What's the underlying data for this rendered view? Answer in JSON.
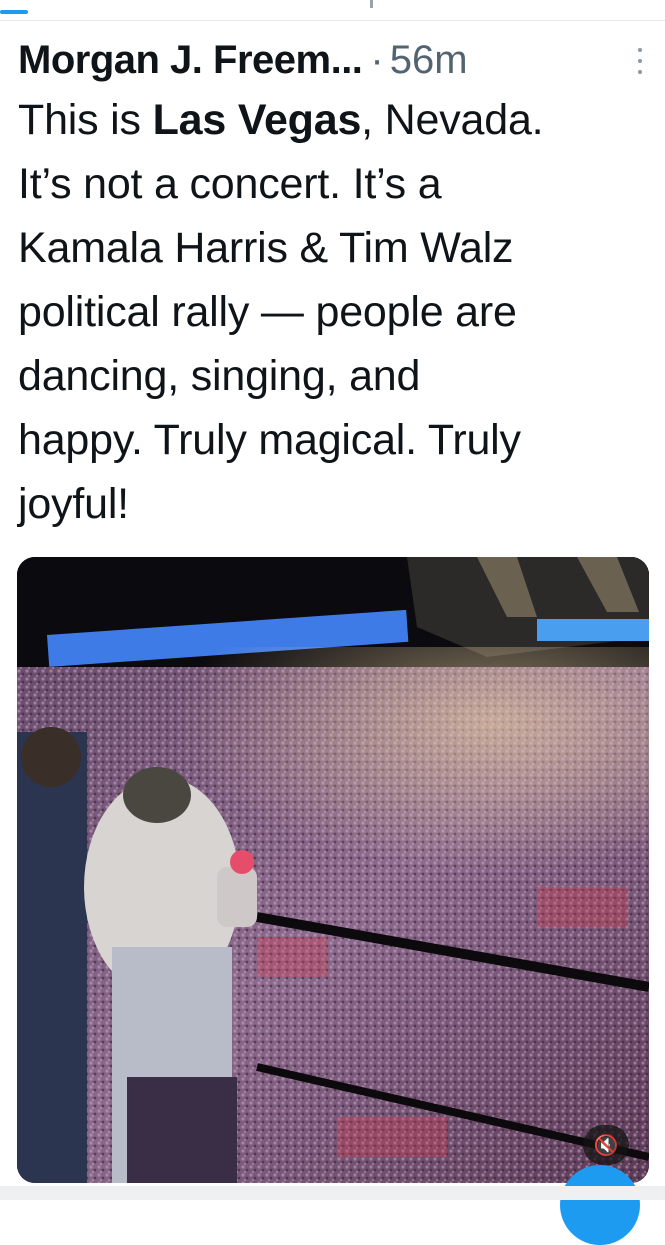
{
  "post": {
    "author_name": "Morgan J. Freem...",
    "separator": "·",
    "timestamp": "56m",
    "text_lines": [
      [
        "This is ",
        "Las Vegas",
        ", Nevada."
      ],
      "It’s not a concert. It’s a",
      "Kamala Harris & Tim Walz",
      "political rally — people are",
      "dancing, singing, and",
      "happy. Truly magical. Truly",
      "joyful!"
    ]
  },
  "media": {
    "type": "video",
    "mute_icon": "speaker-muted-icon"
  },
  "colors": {
    "accent": "#1d9bf0",
    "text": "#0f1419",
    "secondary_text": "#536471"
  }
}
